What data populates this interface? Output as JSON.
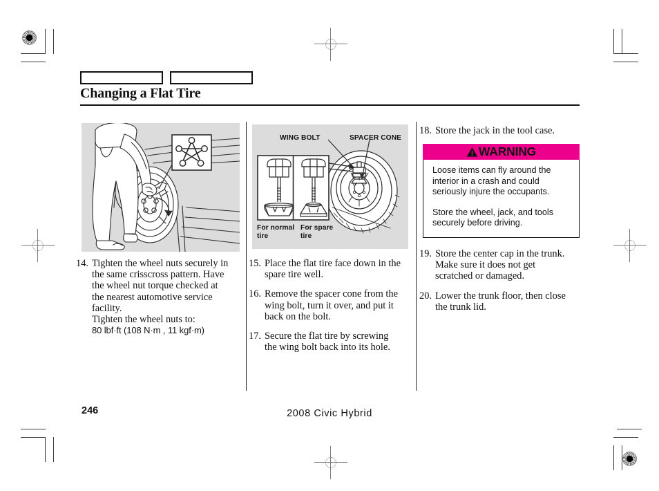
{
  "document": {
    "page_title": "Changing a Flat Tire",
    "page_number": "246",
    "model_line": "2008  Civic  Hybrid"
  },
  "header_tabs": [
    {
      "label": ""
    },
    {
      "label": ""
    }
  ],
  "left_column": {
    "illustration": {
      "name": "tightening-wheel-nuts-illustration",
      "inset_name": "crisscross-pattern-inset"
    },
    "steps": [
      {
        "number": "14.",
        "lines": [
          "Tighten the wheel nuts securely in",
          "the same crisscross pattern. Have",
          "the wheel nut torque checked at",
          "the nearest automotive service",
          "facility.",
          "Tighten the wheel nuts to:"
        ],
        "torque": "80 lbf·ft (108 N·m , 11 kgf·m)"
      }
    ]
  },
  "middle_column": {
    "illustration": {
      "name": "wing-bolt-spacer-cone-illustration",
      "labels": {
        "wing_bolt": "WING BOLT",
        "spacer_cone": "SPACER CONE",
        "for_normal_tire": "For normal\ntire",
        "for_spare_tire": "For spare\ntire"
      }
    },
    "steps": [
      {
        "number": "15.",
        "lines": [
          "Place the flat tire face down in the",
          "spare tire well."
        ]
      },
      {
        "number": "16.",
        "lines": [
          "Remove the spacer cone from the",
          "wing bolt, turn it over, and put it",
          "back on the bolt."
        ]
      },
      {
        "number": "17.",
        "lines": [
          "Secure the flat tire by screwing",
          "the wing bolt back into its hole."
        ]
      }
    ]
  },
  "right_column": {
    "steps_top": [
      {
        "number": "18.",
        "lines": [
          "Store the jack in the tool case."
        ]
      }
    ],
    "warning": {
      "icon": "warning-triangle-icon",
      "label": "WARNING",
      "header_color": "#ec008c",
      "paragraphs": [
        "Loose items can fly around the interior in a crash and could seriously injure the occupants.",
        "Store the wheel, jack, and tools securely before driving."
      ]
    },
    "steps_bottom": [
      {
        "number": "19.",
        "lines": [
          "Store the center cap in the trunk.",
          "Make sure it does not get",
          "scratched or damaged."
        ]
      },
      {
        "number": "20.",
        "lines": [
          "Lower the trunk floor, then close",
          "the trunk lid."
        ]
      }
    ]
  }
}
